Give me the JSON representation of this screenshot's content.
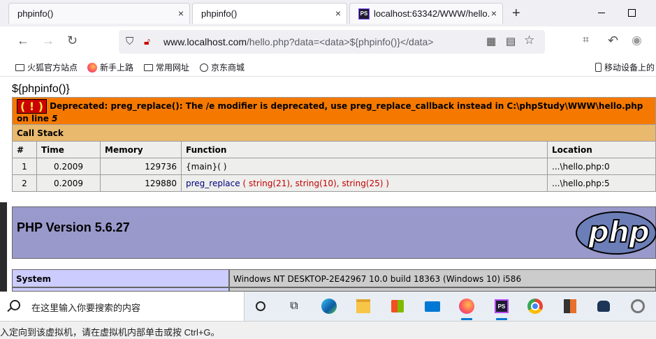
{
  "browser": {
    "tabs": [
      {
        "label": "phpinfo()",
        "close": "×"
      },
      {
        "label": "phpinfo()",
        "close": "×"
      },
      {
        "label": "localhost:63342/WWW/hello.",
        "close": "×",
        "favicon": "PS"
      }
    ],
    "new_tab": "+",
    "url": {
      "host": "www.localhost.com",
      "path": "/hello.php?data=<data>${phpinfo()}</data>"
    },
    "bookmarks": [
      "火狐官方站点",
      "新手上路",
      "常用网址",
      "京东商城",
      "移动设备上的"
    ]
  },
  "page": {
    "echo": "${phpinfo()}",
    "error": {
      "badge": "( ! )",
      "message": "Deprecated: preg_replace(): The /e modifier is deprecated, use preg_replace_callback instead in C:\\phpStudy\\WWW\\hello.php on line ",
      "line": "5"
    },
    "call_stack": {
      "title": "Call Stack",
      "headers": [
        "#",
        "Time",
        "Memory",
        "Function",
        "Location"
      ],
      "rows": [
        {
          "n": "1",
          "time": "0.2009",
          "memory": "129736",
          "function": "{main}( )",
          "location": "...\\hello.php:0"
        },
        {
          "n": "2",
          "time": "0.2009",
          "memory": "129880",
          "function": "preg_replace",
          "args": "( string(21), string(10), string(25) )",
          "location": "...\\hello.php:5"
        }
      ]
    },
    "php_version": "PHP Version 5.6.27",
    "php_logo": "php",
    "system": {
      "label": "System",
      "value": "Windows NT DESKTOP-2E42967 10.0 build 18363 (Windows 10) i586"
    }
  },
  "taskbar": {
    "search_placeholder": "在这里输入你要搜索的内容"
  },
  "statusbar": {
    "text": "入定向到该虚拟机，请在虚拟机内部单击或按 Ctrl+G。"
  },
  "colors": {
    "error_bg": "#f57900",
    "callstack_bg": "#e9b96e",
    "php_header": "#9999cc",
    "system_label": "#ccccff"
  }
}
